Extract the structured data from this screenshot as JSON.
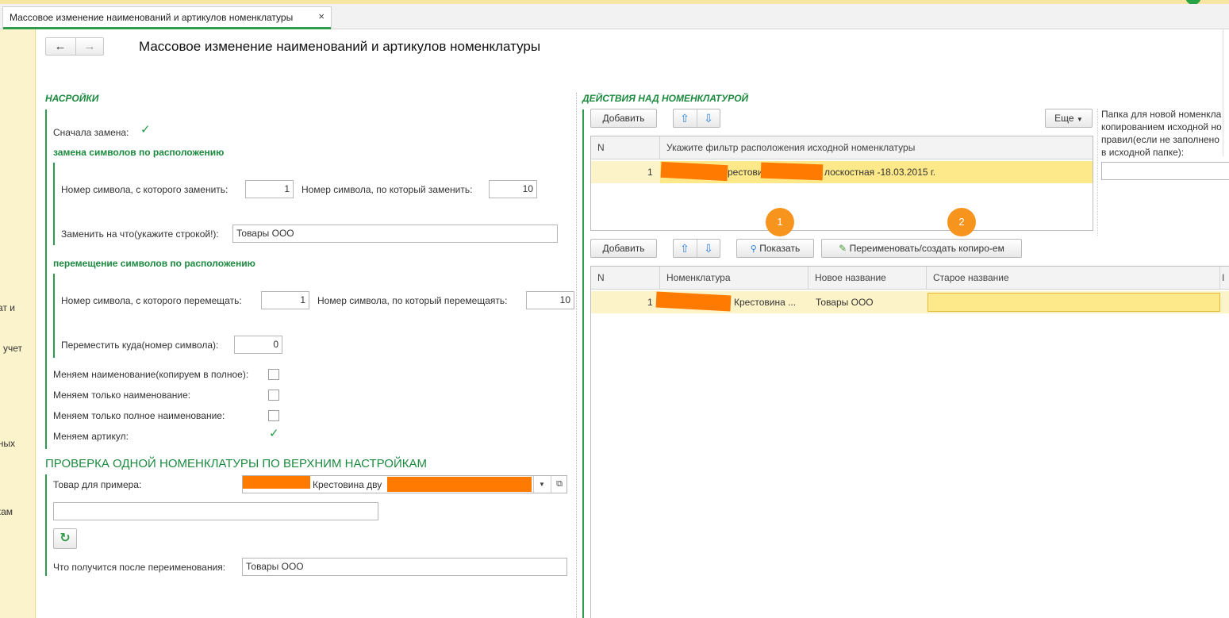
{
  "tab": {
    "title": "Массовое изменение наименований и артикулов номенклатуры",
    "close": "×"
  },
  "sidebar": {
    "fragments": [
      "ат и",
      "учет",
      "ных",
      "кам"
    ]
  },
  "nav": {
    "back": "←",
    "forward": "→"
  },
  "page_title": "Массовое изменение наименований и артикулов номенклатуры",
  "settings": {
    "heading": "НАСРОЙКИ",
    "replace_first_label": "Сначала замена:",
    "replace_first_checked": true,
    "replace_section": "замена символов по расположению",
    "replace_from_label": "Номер символа, с которого заменить:",
    "replace_from_value": "1",
    "replace_to_label": "Номер символа, по который заменить:",
    "replace_to_value": "10",
    "replace_with_label": "Заменить на что(укажите строкой!):",
    "replace_with_value": "Товары ООО",
    "move_section": "перемещение символов по расположению",
    "move_from_label": "Номер символа, с которого перемещать:",
    "move_from_value": "1",
    "move_to_label": "Номер символа, по который перемещаять:",
    "move_to_value": "10",
    "move_where_label": "Переместить куда(номер символа):",
    "move_where_value": "0",
    "checkboxes": [
      {
        "label": "Меняем наименование(копируем в полное):",
        "checked": false
      },
      {
        "label": "Меняем только наименование:",
        "checked": false
      },
      {
        "label": "Меняем только полное наименование:",
        "checked": false
      },
      {
        "label": "Меняем артикул:",
        "checked": true
      }
    ]
  },
  "check": {
    "heading": "ПРОВЕРКА ОДНОЙ НОМЕНКЛАТУРЫ ПО ВЕРХНИМ НАСТРОЙКАМ",
    "product_label": "Товар для примера:",
    "product_value": "Крестовина дву",
    "result_label": "Что получится после переименования:",
    "result_value": "Товары ООО",
    "refresh_icon": "↻"
  },
  "actions": {
    "heading": "ДЕЙСТВИЯ НАД НОМЕНКЛАТУРОЙ",
    "add_label": "Добавить",
    "more_label": "Еще",
    "show_label": "Показать",
    "rename_label": "Переименовать/создать копиро-ем",
    "filter_table": {
      "columns": [
        "N",
        "Укажите фильтр расположения исходной номенклатуры"
      ],
      "rows": [
        {
          "n": "1",
          "parts": [
            "рестовин",
            "лоскостная -18.03.2015 г."
          ]
        }
      ]
    },
    "items_table": {
      "columns": [
        "N",
        "Номенклатура",
        "Новое название",
        "Старое название",
        "I"
      ],
      "rows": [
        {
          "n": "1",
          "item": "Крестовина ...",
          "new_name": "Товары ООО",
          "old_name": ""
        }
      ]
    },
    "badges": [
      "1",
      "2"
    ]
  },
  "folder": {
    "lines": [
      "Папка для новой номенкла",
      "копированием исходной но",
      "правил(если не заполнено",
      "в исходной папке):"
    ]
  },
  "colors": {
    "accent_green": "#1b8a3e",
    "selection_yellow": "#fde98a",
    "badge_orange": "#f7941d",
    "redaction": "#ff7a00"
  }
}
